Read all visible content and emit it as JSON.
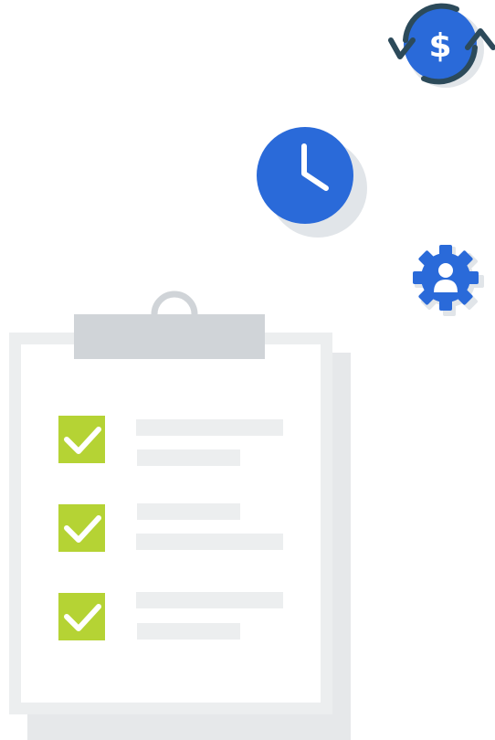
{
  "illustration": {
    "dollar_symbol": "$",
    "icons": [
      "currency-exchange-icon",
      "clock-icon",
      "user-settings-icon",
      "clipboard-icon",
      "checkbox-icon"
    ],
    "checklist_items": [
      {
        "checked": true
      },
      {
        "checked": true
      },
      {
        "checked": true
      }
    ]
  },
  "colors": {
    "accent_blue": "#2a6ad9",
    "dark_arrow": "#2c4a5a",
    "check_green": "#b5d334",
    "clip_gray": "#d0d4d8",
    "clipboard_shadow": "#e6e8ea",
    "clipboard_frame": "#eceeef",
    "line_gray": "#eceeef",
    "icon_shadow": "#e1e5e9"
  }
}
